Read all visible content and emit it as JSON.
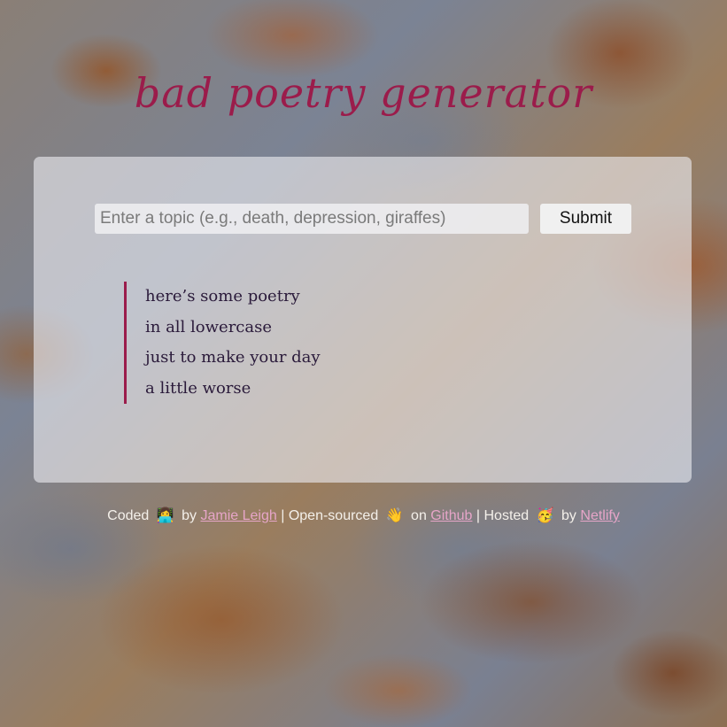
{
  "header": {
    "title": "bad poetry generator"
  },
  "form": {
    "topic_placeholder": "Enter a topic (e.g., death, depression, giraffes)",
    "topic_value": "",
    "submit_label": "Submit"
  },
  "poem": {
    "lines": [
      "here’s some poetry",
      "in all lowercase",
      "just to make your day",
      "a little worse"
    ]
  },
  "footer": {
    "coded_text": "Coded",
    "coded_emoji": "👩‍💻",
    "by_text_1": "by",
    "author_link": "Jamie Leigh",
    "separator_1": "|",
    "open_sourced_text": "Open-sourced",
    "open_sourced_emoji": "👋",
    "on_text": "on",
    "github_link": "Github",
    "separator_2": "|",
    "hosted_text": "Hosted",
    "hosted_emoji": "🥳",
    "by_text_2": "by",
    "netlify_link": "Netlify"
  },
  "colors": {
    "accent": "#9b1c4b",
    "link": "#e6a5c8",
    "poem_text": "#2a1a3a"
  }
}
